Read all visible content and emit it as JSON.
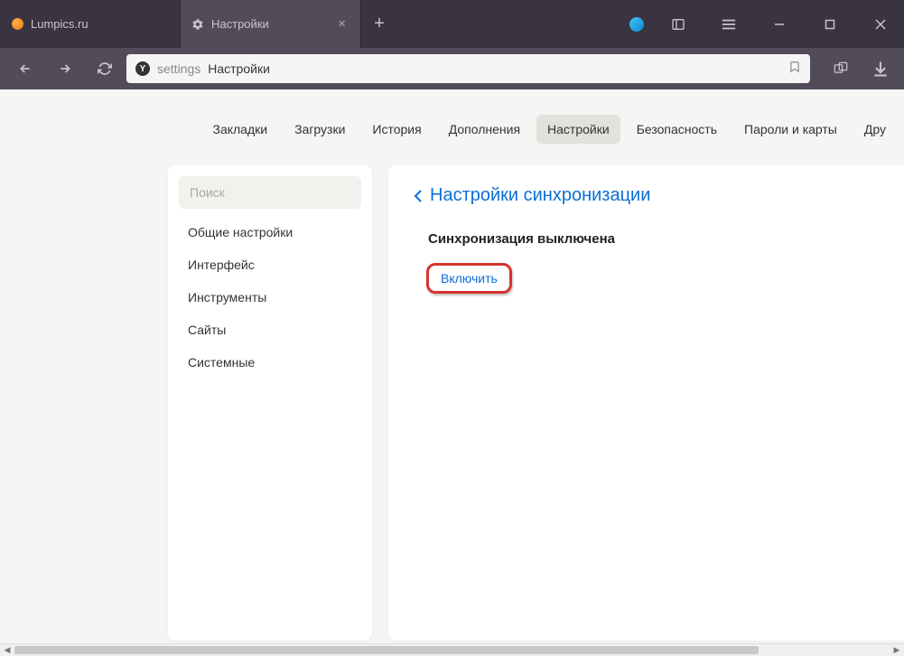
{
  "tabs": [
    {
      "title": "Lumpics.ru",
      "active": false
    },
    {
      "title": "Настройки",
      "active": true
    }
  ],
  "address": {
    "scheme": "settings",
    "path": "Настройки"
  },
  "topnav": {
    "items": [
      {
        "label": "Закладки"
      },
      {
        "label": "Загрузки"
      },
      {
        "label": "История"
      },
      {
        "label": "Дополнения"
      },
      {
        "label": "Настройки",
        "active": true
      },
      {
        "label": "Безопасность"
      },
      {
        "label": "Пароли и карты"
      },
      {
        "label": "Дру"
      }
    ]
  },
  "sidebar": {
    "search_placeholder": "Поиск",
    "items": [
      {
        "label": "Общие настройки"
      },
      {
        "label": "Интерфейс"
      },
      {
        "label": "Инструменты"
      },
      {
        "label": "Сайты"
      },
      {
        "label": "Системные"
      }
    ]
  },
  "panel": {
    "breadcrumb": "Настройки синхронизации",
    "title": "Синхронизация выключена",
    "enable_label": "Включить"
  }
}
